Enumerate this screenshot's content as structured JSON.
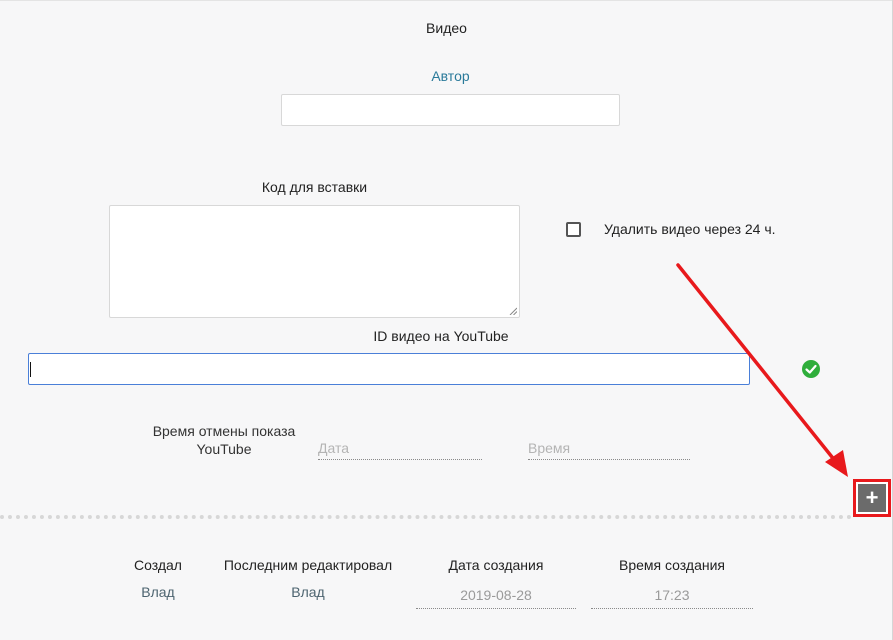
{
  "section": {
    "title": "Видео"
  },
  "author": {
    "label": "Автор",
    "value": ""
  },
  "embed": {
    "label": "Код для вставки",
    "value": ""
  },
  "auto_delete": {
    "label": "Удалить видео через 24 ч.",
    "checked": false
  },
  "youtube": {
    "label": "ID видео на YouTube",
    "value": "",
    "status_icon": "check-circle-icon"
  },
  "cancel_time": {
    "label": "Время отмены показа YouTube",
    "date_placeholder": "Дата",
    "time_placeholder": "Время"
  },
  "add_button": {
    "label": "+"
  },
  "meta": {
    "created_by_label": "Создал",
    "created_by": "Влад",
    "edited_by_label": "Последним редактировал",
    "edited_by": "Влад",
    "created_date_label": "Дата создания",
    "created_date": "2019-08-28",
    "created_time_label": "Время создания",
    "created_time": "17:23"
  },
  "colors": {
    "accent_link": "#2a7a9a",
    "highlight": "#e8191c",
    "success": "#2fae3b",
    "focus_border": "#4a7fd8"
  }
}
